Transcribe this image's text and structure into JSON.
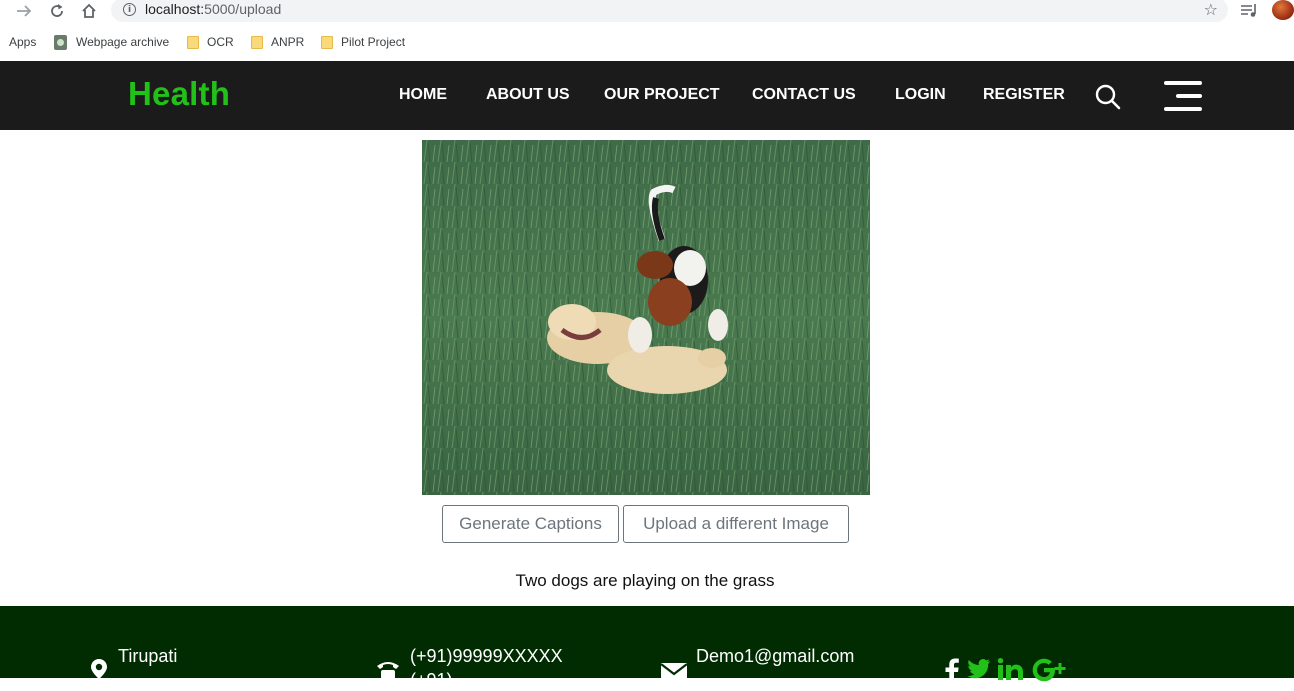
{
  "browser": {
    "url_host": "localhost:",
    "url_path": "5000/upload",
    "bookmarks": [
      {
        "label": "Apps"
      },
      {
        "label": "Webpage archive"
      },
      {
        "label": "OCR"
      },
      {
        "label": "ANPR"
      },
      {
        "label": "Pilot Project"
      }
    ]
  },
  "site": {
    "brand": "Health",
    "menu": [
      "HOME",
      "ABOUT US",
      "OUR PROJECT",
      "CONTACT US",
      "LOGIN",
      "REGISTER"
    ],
    "accent_color": "#22c11a",
    "nav_bg": "#1b1b1b"
  },
  "main": {
    "generate_label": "Generate Captions",
    "upload_label": "Upload a different Image",
    "caption": "Two dogs are playing on the grass"
  },
  "footer": {
    "location": "Tirupati",
    "phone": "(+91)99999XXXXX",
    "phone_partial": "(+91)",
    "email": "Demo1@gmail.com",
    "bg_color": "#012c02"
  }
}
